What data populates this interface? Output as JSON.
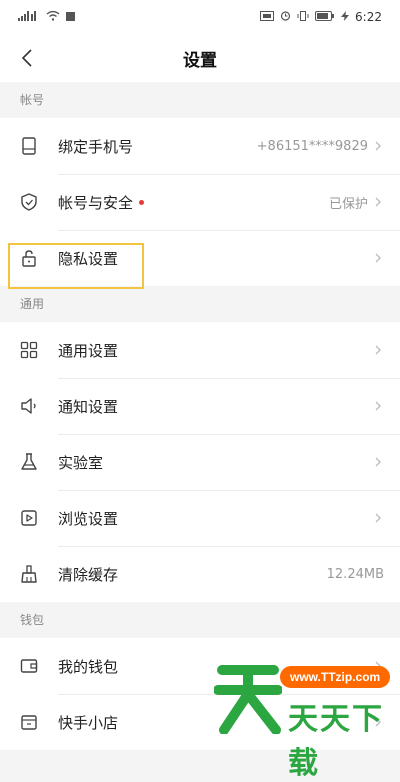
{
  "status_bar": {
    "time": "6:22",
    "battery": ""
  },
  "nav": {
    "title": "设置"
  },
  "sections": [
    {
      "header": "帐号",
      "items": [
        {
          "label": "绑定手机号",
          "value": "+86151****9829",
          "dot": false,
          "icon": "phone-icon"
        },
        {
          "label": "帐号与安全",
          "value": "已保护",
          "dot": true,
          "icon": "shield-icon"
        },
        {
          "label": "隐私设置",
          "value": "",
          "dot": false,
          "icon": "lock-icon"
        }
      ]
    },
    {
      "header": "通用",
      "items": [
        {
          "label": "通用设置",
          "value": "",
          "icon": "grid-icon"
        },
        {
          "label": "通知设置",
          "value": "",
          "icon": "speaker-icon"
        },
        {
          "label": "实验室",
          "value": "",
          "icon": "flask-icon"
        },
        {
          "label": "浏览设置",
          "value": "",
          "icon": "play-icon"
        },
        {
          "label": "清除缓存",
          "value": "12.24MB",
          "icon": "broom-icon"
        }
      ]
    },
    {
      "header": "钱包",
      "items": [
        {
          "label": "我的钱包",
          "value": "",
          "icon": "wallet-icon"
        },
        {
          "label": "快手小店",
          "value": "",
          "icon": "shop-icon"
        }
      ]
    }
  ],
  "watermark": {
    "site": "www.TTzip.com",
    "text": "天天下载",
    "logo_char": "天"
  },
  "colors": {
    "highlight": "#f2c541",
    "accent_dot": "#e53935",
    "watermark_green": "#2ba640",
    "watermark_orange": "#ff6a00"
  }
}
